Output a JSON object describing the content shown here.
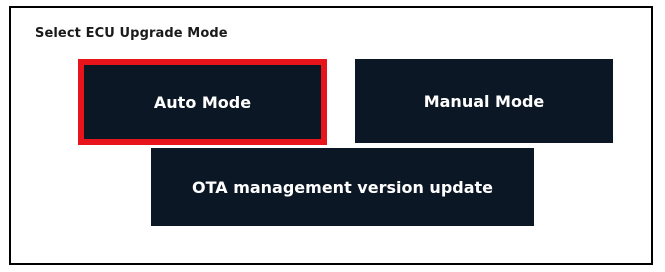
{
  "dialog": {
    "title": "Select ECU Upgrade Mode",
    "buttons": {
      "auto": "Auto Mode",
      "manual": "Manual Mode",
      "ota": "OTA management version update"
    }
  },
  "colors": {
    "button_background": "#0b1724",
    "highlight_border": "#e8141b"
  }
}
